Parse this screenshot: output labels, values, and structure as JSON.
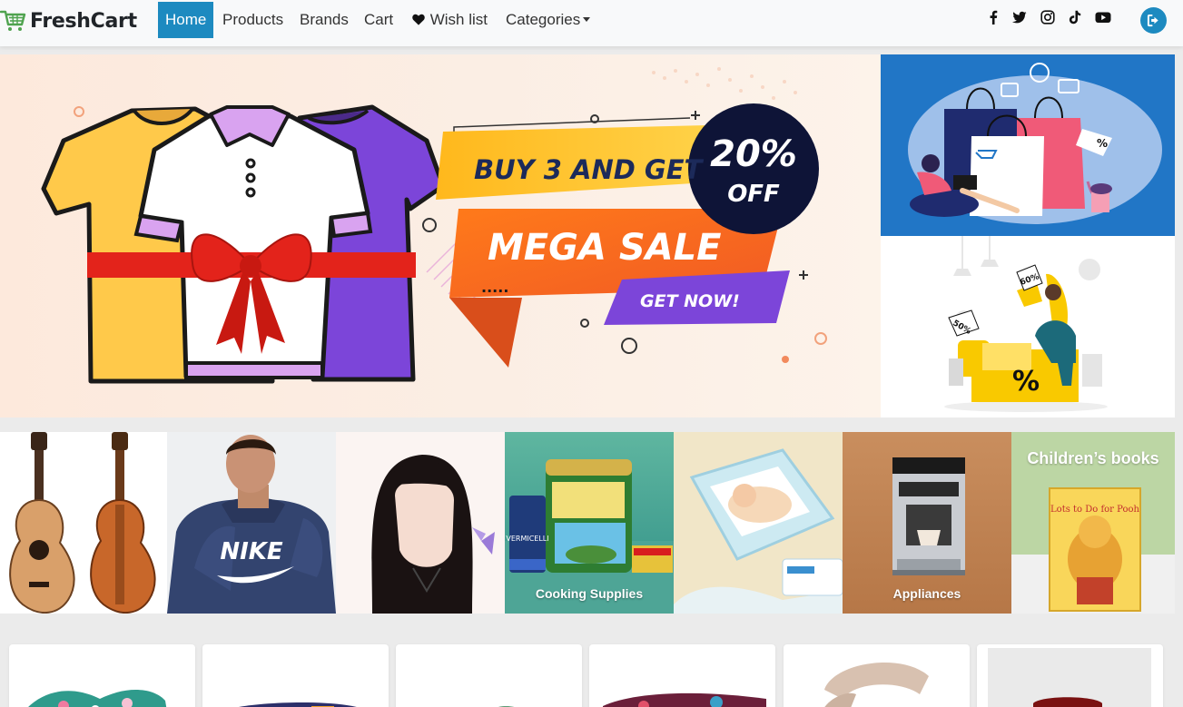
{
  "brand": {
    "name": "FreshCart",
    "color": "#4fa34f"
  },
  "nav": {
    "links": [
      "Home",
      "Products",
      "Brands",
      "Cart",
      "Wish list",
      "Categories"
    ],
    "active": "Home",
    "accent": "#1d8ac0"
  },
  "social_icons": [
    "facebook-icon",
    "twitter-icon",
    "instagram-icon",
    "tiktok-icon",
    "youtube-icon"
  ],
  "logout_icon": "sign-out-icon",
  "hero": {
    "main": {
      "line1": "BUY 3 AND GET",
      "percent": "20%",
      "off": "OFF",
      "headline": "MEGA SALE",
      "cta": "GET NOW!"
    },
    "side_top_tag": "%",
    "side_bottom": {
      "tag1": "60%",
      "tag2": "50%",
      "symbol": "%"
    }
  },
  "categories": [
    {
      "name": "guitar",
      "label": ""
    },
    {
      "name": "mens-hoodie",
      "label": "",
      "print": "NIKE"
    },
    {
      "name": "beauty-portrait",
      "label": ""
    },
    {
      "name": "cooking-supplies",
      "label": "Cooking Supplies",
      "pack_label": "VERMICELLI"
    },
    {
      "name": "baby-diapers",
      "label": ""
    },
    {
      "name": "appliances",
      "label": "Appliances"
    },
    {
      "name": "childrens-books",
      "label": "Children’s books",
      "book_title": "Lots to Do for Pooh"
    }
  ],
  "products": [
    {
      "name": "printed-scarf-1"
    },
    {
      "name": "printed-scarf-2"
    },
    {
      "name": "printed-scarf-3"
    },
    {
      "name": "printed-scarf-4"
    },
    {
      "name": "beige-scarf"
    },
    {
      "name": "red-top"
    }
  ]
}
